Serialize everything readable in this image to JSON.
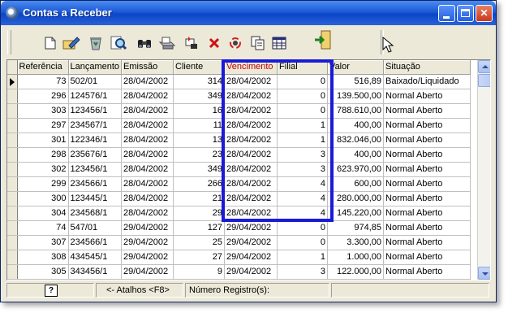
{
  "window": {
    "title": "Contas a Receber"
  },
  "toolbar": {
    "tools": [
      {
        "name": "new-document-icon"
      },
      {
        "name": "edit-icon"
      },
      {
        "name": "recycle-bin-icon"
      },
      {
        "name": "search-icon"
      },
      {
        "name": "binoculars-icon"
      },
      {
        "name": "print-icon"
      },
      {
        "name": "sort-icon"
      },
      {
        "name": "delete-icon"
      },
      {
        "name": "refresh-icon"
      },
      {
        "name": "copy-icon"
      },
      {
        "name": "table-icon"
      },
      {
        "name": "exit-door-icon"
      }
    ]
  },
  "grid": {
    "columns": [
      "Referência",
      "Lançamento",
      "Emissão",
      "Cliente",
      "Vencimento",
      "Filial",
      "Valor",
      "Situação"
    ],
    "rows": [
      {
        "ref": "73",
        "lanc": "502/01",
        "emissao": "28/04/2002",
        "cliente": "314",
        "venc": "28/04/2002",
        "filial": "0",
        "valor": "516,89",
        "situacao": "Baixado/Liquidado",
        "current": true
      },
      {
        "ref": "296",
        "lanc": "124576/1",
        "emissao": "28/04/2002",
        "cliente": "349",
        "venc": "28/04/2002",
        "filial": "0",
        "valor": "139.500,00",
        "situacao": "Normal Aberto"
      },
      {
        "ref": "303",
        "lanc": "123456/1",
        "emissao": "28/04/2002",
        "cliente": "16",
        "venc": "28/04/2002",
        "filial": "0",
        "valor": "788.610,00",
        "situacao": "Normal Aberto"
      },
      {
        "ref": "297",
        "lanc": "234567/1",
        "emissao": "28/04/2002",
        "cliente": "11",
        "venc": "28/04/2002",
        "filial": "1",
        "valor": "400,00",
        "situacao": "Normal Aberto"
      },
      {
        "ref": "301",
        "lanc": "122346/1",
        "emissao": "28/04/2002",
        "cliente": "13",
        "venc": "28/04/2002",
        "filial": "1",
        "valor": "832.046,00",
        "situacao": "Normal Aberto"
      },
      {
        "ref": "298",
        "lanc": "235676/1",
        "emissao": "28/04/2002",
        "cliente": "23",
        "venc": "28/04/2002",
        "filial": "3",
        "valor": "400,00",
        "situacao": "Normal Aberto"
      },
      {
        "ref": "302",
        "lanc": "123456/1",
        "emissao": "28/04/2002",
        "cliente": "349",
        "venc": "28/04/2002",
        "filial": "3",
        "valor": "623.970,00",
        "situacao": "Normal Aberto"
      },
      {
        "ref": "299",
        "lanc": "234566/1",
        "emissao": "28/04/2002",
        "cliente": "266",
        "venc": "28/04/2002",
        "filial": "4",
        "valor": "600,00",
        "situacao": "Normal Aberto"
      },
      {
        "ref": "300",
        "lanc": "123445/1",
        "emissao": "28/04/2002",
        "cliente": "21",
        "venc": "28/04/2002",
        "filial": "4",
        "valor": "280.000,00",
        "situacao": "Normal Aberto"
      },
      {
        "ref": "304",
        "lanc": "234568/1",
        "emissao": "28/04/2002",
        "cliente": "29",
        "venc": "28/04/2002",
        "filial": "4",
        "valor": "145.220,00",
        "situacao": "Normal Aberto"
      },
      {
        "ref": "74",
        "lanc": "547/01",
        "emissao": "29/04/2002",
        "cliente": "127",
        "venc": "29/04/2002",
        "filial": "0",
        "valor": "974,85",
        "situacao": "Normal Aberto"
      },
      {
        "ref": "307",
        "lanc": "234566/1",
        "emissao": "29/04/2002",
        "cliente": "25",
        "venc": "29/04/2002",
        "filial": "0",
        "valor": "3.300,00",
        "situacao": "Normal Aberto"
      },
      {
        "ref": "308",
        "lanc": "434545/1",
        "emissao": "29/04/2002",
        "cliente": "27",
        "venc": "29/04/2002",
        "filial": "1",
        "valor": "1.000,00",
        "situacao": "Normal Aberto"
      },
      {
        "ref": "305",
        "lanc": "343456/1",
        "emissao": "29/04/2002",
        "cliente": "9",
        "venc": "29/04/2002",
        "filial": "3",
        "valor": "122.000,00",
        "situacao": "Normal Aberto"
      }
    ]
  },
  "highlight": {
    "color": "#1a1ad8"
  },
  "colors": {
    "title_bar": "#0a46c8",
    "vencimento_header": "#c00000",
    "window_bg": "#ece9d8"
  },
  "statusbar": {
    "help_label": "?",
    "shortcuts": "<- Atalhos <F8>",
    "record_count_label": "Número Registro(s):"
  }
}
